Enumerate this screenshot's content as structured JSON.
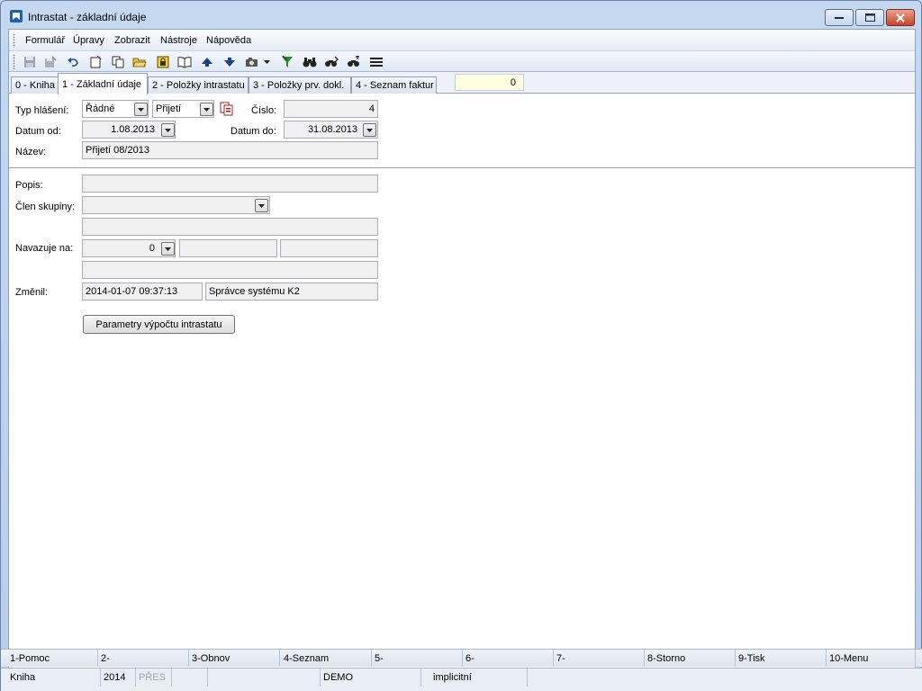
{
  "window": {
    "title": "Intrastat - základní údaje"
  },
  "menu": {
    "items": [
      "Formulář",
      "Úpravy",
      "Zobrazit",
      "Nástroje",
      "Nápověda"
    ]
  },
  "toolbar": {
    "icons": [
      "save-icon",
      "save-as-icon",
      "undo-icon",
      "new-icon",
      "copy-icon",
      "open-folder-icon",
      "lock-icon",
      "book-icon",
      "arrow-up-icon",
      "arrow-down-icon",
      "camera-icon",
      "filter-icon",
      "binoculars-icon",
      "find-next-icon",
      "find-replace-icon",
      "menu-lines-icon"
    ]
  },
  "tabs": {
    "items": [
      "0 - Kniha",
      "1 - Základní údaje",
      "2 - Položky intrastatu",
      "3 - Položky prv. dokl.",
      "4 - Seznam faktur"
    ],
    "active_index": 1,
    "counter": "0"
  },
  "form": {
    "typ_hlaseni_label": "Typ hlášení:",
    "typ_hlaseni_value": "Řádné",
    "smer_value": "Přijetí",
    "cislo_label": "Číslo:",
    "cislo_value": "4",
    "datum_od_label": "Datum od:",
    "datum_od_value": "1.08.2013",
    "datum_do_label": "Datum do:",
    "datum_do_value": "31.08.2013",
    "nazev_label": "Název:",
    "nazev_value": "Přijetí 08/2013",
    "popis_label": "Popis:",
    "popis_value": "",
    "clen_skupiny_label": "Člen skupiny:",
    "clen_skupiny_value": "",
    "navazuje_label": "Navazuje na:",
    "navazuje_value": "0",
    "zmenil_label": "Změnil:",
    "zmenil_datetime": "2014-01-07 09:37:13",
    "zmenil_user": "Správce systému K2",
    "parametry_button": "Parametry výpočtu intrastatu"
  },
  "function_keys": [
    "1-Pomoc",
    "2-",
    "3-Obnov",
    "4-Seznam",
    "5-",
    "6-",
    "7-",
    "8-Storno",
    "9-Tisk",
    "10-Menu"
  ],
  "status": {
    "book": "Kniha",
    "year": "2014",
    "mode": "PŘES",
    "db": "DEMO",
    "profile": "implicitní"
  },
  "colors": {
    "counter_bg": "#ffffe1",
    "close_button": "#c7442b",
    "field_bg": "#f0f0f0"
  }
}
